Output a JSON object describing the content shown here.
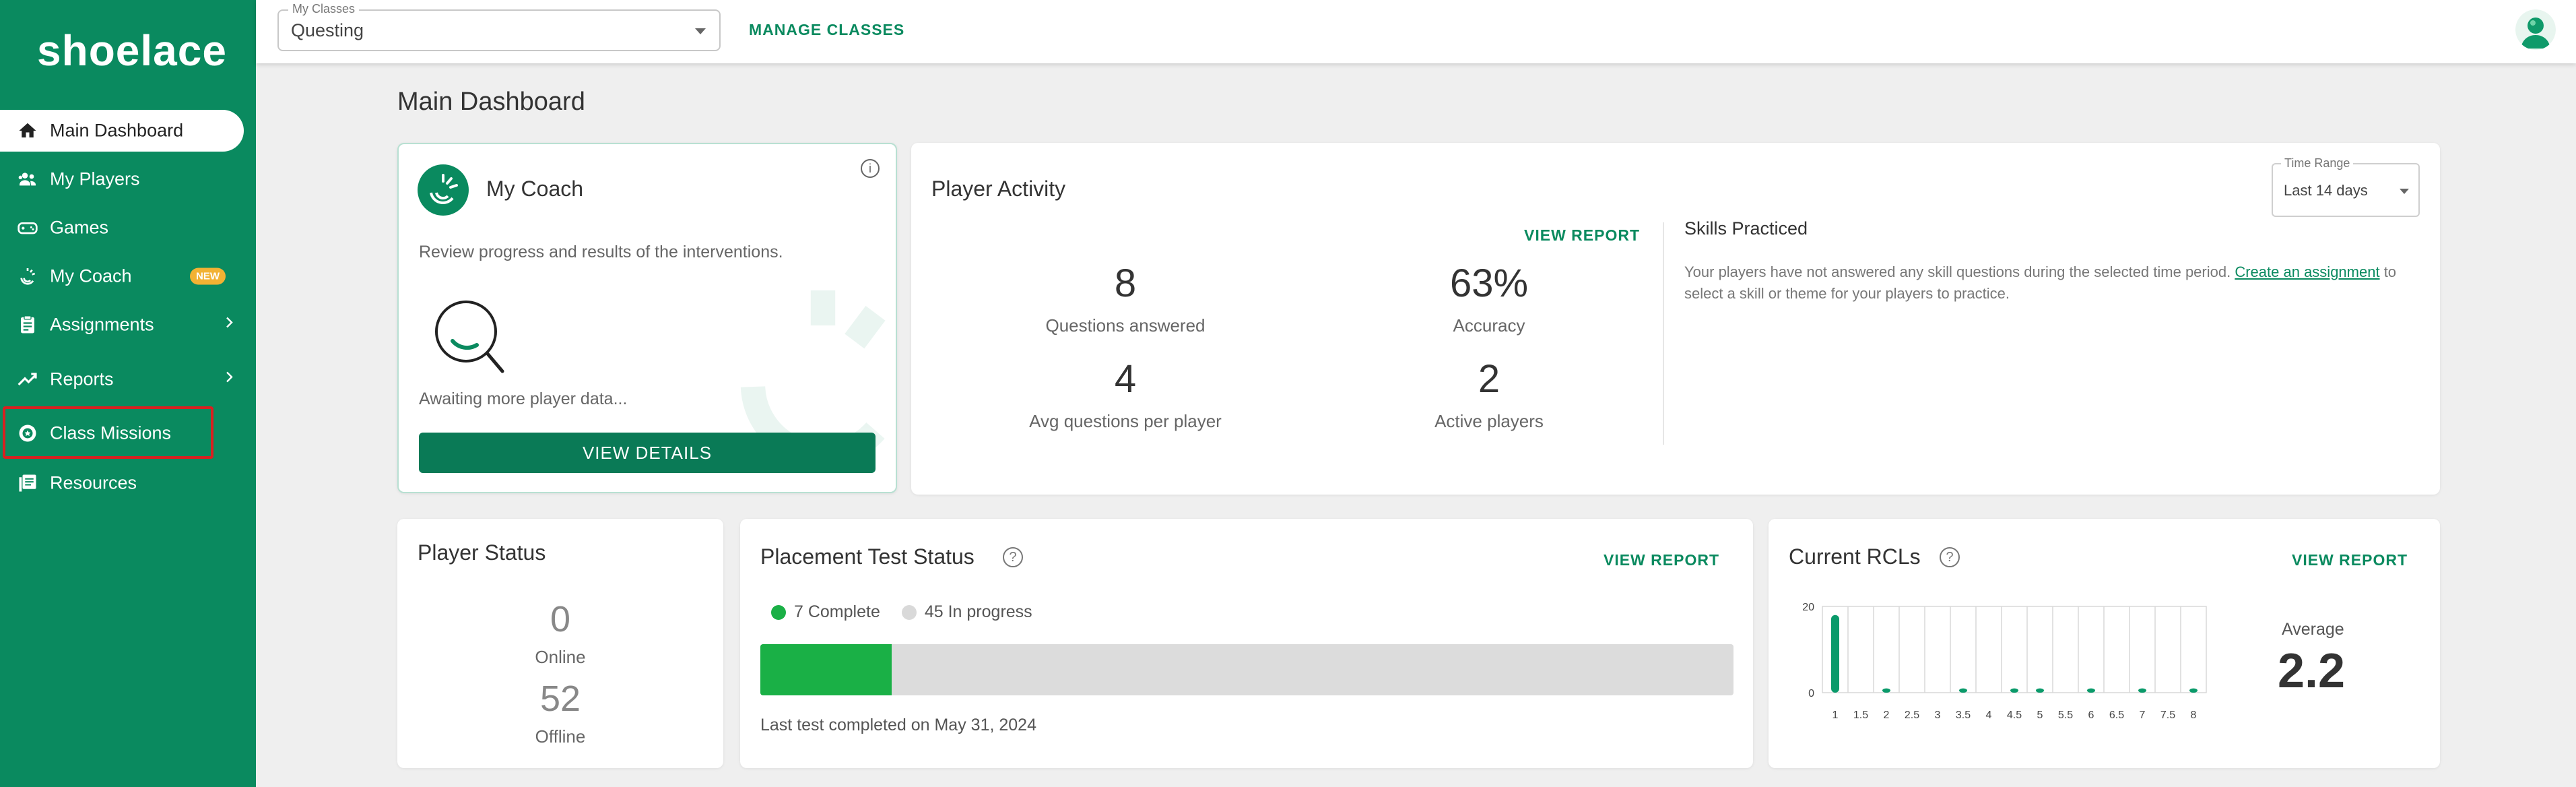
{
  "app": {
    "logo_text": "shoelace"
  },
  "sidebar": {
    "items": [
      {
        "label": "Main Dashboard",
        "icon": "home-icon"
      },
      {
        "label": "My Players",
        "icon": "people-icon"
      },
      {
        "label": "Games",
        "icon": "gamepad-icon"
      },
      {
        "label": "My Coach",
        "icon": "coach-icon",
        "badge": "NEW"
      },
      {
        "label": "Assignments",
        "icon": "clipboard-icon"
      },
      {
        "label": "Reports",
        "icon": "trending-icon"
      },
      {
        "label": "Class Missions",
        "icon": "mission-badge-icon"
      },
      {
        "label": "Resources",
        "icon": "library-icon"
      }
    ]
  },
  "topbar": {
    "class_select_legend": "My Classes",
    "class_select_value": "Questing",
    "manage_classes": "MANAGE CLASSES"
  },
  "main": {
    "title": "Main Dashboard",
    "coach": {
      "title": "My Coach",
      "description": "Review progress and results of the interventions.",
      "awaiting": "Awaiting more player data...",
      "button": "VIEW DETAILS"
    },
    "activity": {
      "title": "Player Activity",
      "view_report": "VIEW REPORT",
      "time_range_legend": "Time Range",
      "time_range_value": "Last 14 days",
      "stats": [
        {
          "value": "8",
          "label": "Questions answered"
        },
        {
          "value": "63%",
          "label": "Accuracy"
        },
        {
          "value": "4",
          "label": "Avg questions per player"
        },
        {
          "value": "2",
          "label": "Active players"
        }
      ],
      "skills_title": "Skills Practiced",
      "skills_text_before": "Your players have not answered any skill questions during the selected time period. ",
      "skills_link": "Create an assignment",
      "skills_text_after": " to select a skill or theme for your players to practice."
    },
    "player_status": {
      "title": "Player Status",
      "online_value": "0",
      "online_label": "Online",
      "offline_value": "52",
      "offline_label": "Offline"
    },
    "placement": {
      "title": "Placement Test Status",
      "view_report": "VIEW REPORT",
      "complete_label": "7 Complete",
      "in_progress_label": "45 In progress",
      "complete_color": "#1ab046",
      "in_progress_color": "#d9d9d9",
      "complete_fraction": 0.135,
      "last_completed": "Last test completed on May 31, 2024"
    },
    "rcl": {
      "title": "Current RCLs",
      "view_report": "VIEW REPORT",
      "average_label": "Average",
      "average_value": "2.2"
    }
  },
  "chart_data": {
    "type": "bar",
    "categories": [
      "1",
      "1.5",
      "2",
      "2.5",
      "3",
      "3.5",
      "4",
      "4.5",
      "5",
      "5.5",
      "6",
      "6.5",
      "7",
      "7.5",
      "8"
    ],
    "values": [
      18,
      0,
      1,
      0,
      0,
      1,
      0,
      1,
      1,
      0,
      1,
      0,
      1,
      0,
      1
    ],
    "y_ticks": [
      "0",
      "20"
    ],
    "ylim": [
      0,
      20
    ],
    "bar_color": "#0a9a6a",
    "grid": "vertical"
  }
}
